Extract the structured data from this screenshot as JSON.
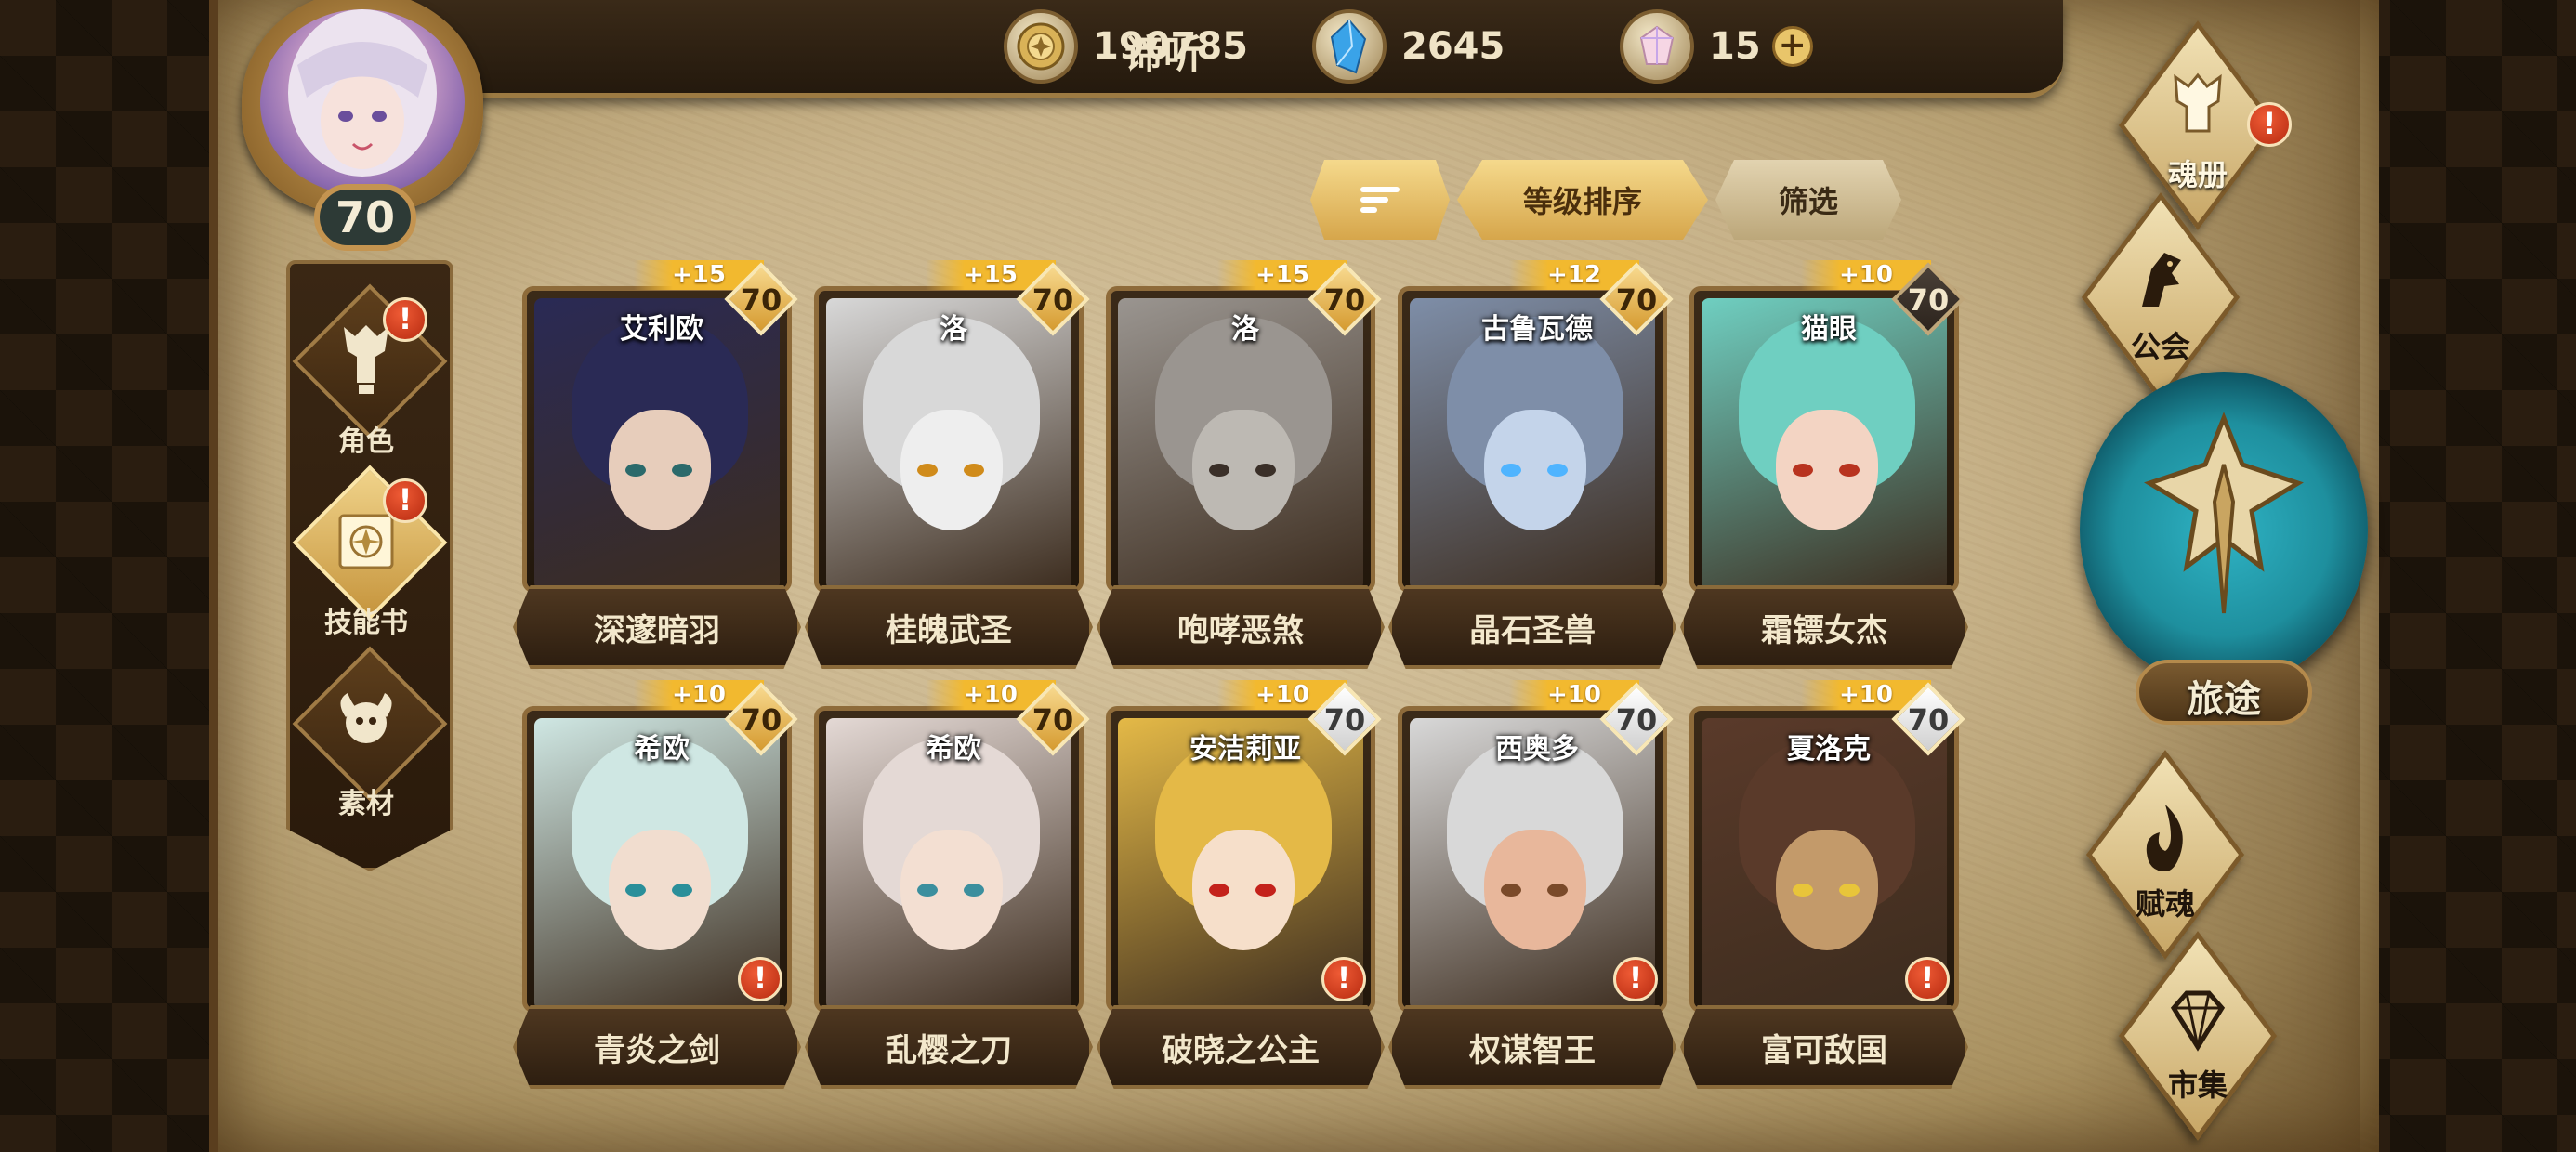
{
  "player": {
    "name": "谛听",
    "level": "70"
  },
  "currencies": [
    {
      "icon": "gold-coin-icon",
      "value": "190785"
    },
    {
      "icon": "blue-crystal-icon",
      "value": "2645"
    },
    {
      "icon": "rainbow-gem-icon",
      "value": "15"
    }
  ],
  "sidenav": [
    {
      "label": "角色",
      "icon": "character-icon",
      "alert": "!"
    },
    {
      "label": "技能书",
      "icon": "skill-book-icon",
      "alert": "!"
    },
    {
      "label": "素材",
      "icon": "material-icon"
    }
  ],
  "sort": {
    "icon_label": "sort-lines-icon",
    "level_sort": "等级排序",
    "filter": "筛选"
  },
  "cards": [
    {
      "title": "深邃暗羽",
      "char": "艾利欧",
      "level": "70",
      "bonus": "+15",
      "frame": "gold"
    },
    {
      "title": "桂魄武圣",
      "char": "洛",
      "level": "70",
      "bonus": "+15",
      "frame": "gold"
    },
    {
      "title": "咆哮恶煞",
      "char": "洛",
      "level": "70",
      "bonus": "+15",
      "frame": "gold"
    },
    {
      "title": "晶石圣兽",
      "char": "古鲁瓦德",
      "level": "70",
      "bonus": "+12",
      "frame": "gold"
    },
    {
      "title": "霜镖女杰",
      "char": "猫眼",
      "level": "70",
      "bonus": "+10",
      "frame": "dark"
    },
    {
      "title": "青炎之剑",
      "char": "希欧",
      "level": "70",
      "bonus": "+10",
      "frame": "gold",
      "alert": "!"
    },
    {
      "title": "乱樱之刀",
      "char": "希欧",
      "level": "70",
      "bonus": "+10",
      "frame": "gold"
    },
    {
      "title": "破晓之公主",
      "char": "安洁莉亚",
      "level": "70",
      "bonus": "+10",
      "frame": "silver",
      "alert": "!"
    },
    {
      "title": "权谋智王",
      "char": "西奥多",
      "level": "70",
      "bonus": "+10",
      "frame": "silver",
      "alert": "!"
    },
    {
      "title": "富可敌国",
      "char": "夏洛克",
      "level": "70",
      "bonus": "+10",
      "frame": "silver",
      "alert": "!"
    }
  ],
  "rightnav": [
    {
      "label": "魂册",
      "icon": "soul-book-icon",
      "alert": "!"
    },
    {
      "label": "公会",
      "icon": "guild-icon"
    },
    {
      "label": "旅途",
      "icon": "journey-emblem-icon"
    },
    {
      "label": "赋魂",
      "icon": "soul-flame-icon"
    },
    {
      "label": "市集",
      "icon": "market-gem-icon"
    }
  ],
  "colors": {
    "gold": "#e0b04a",
    "parchment": "#c8b38a",
    "teal": "#2fb3c4",
    "alert": "#d83a16"
  }
}
